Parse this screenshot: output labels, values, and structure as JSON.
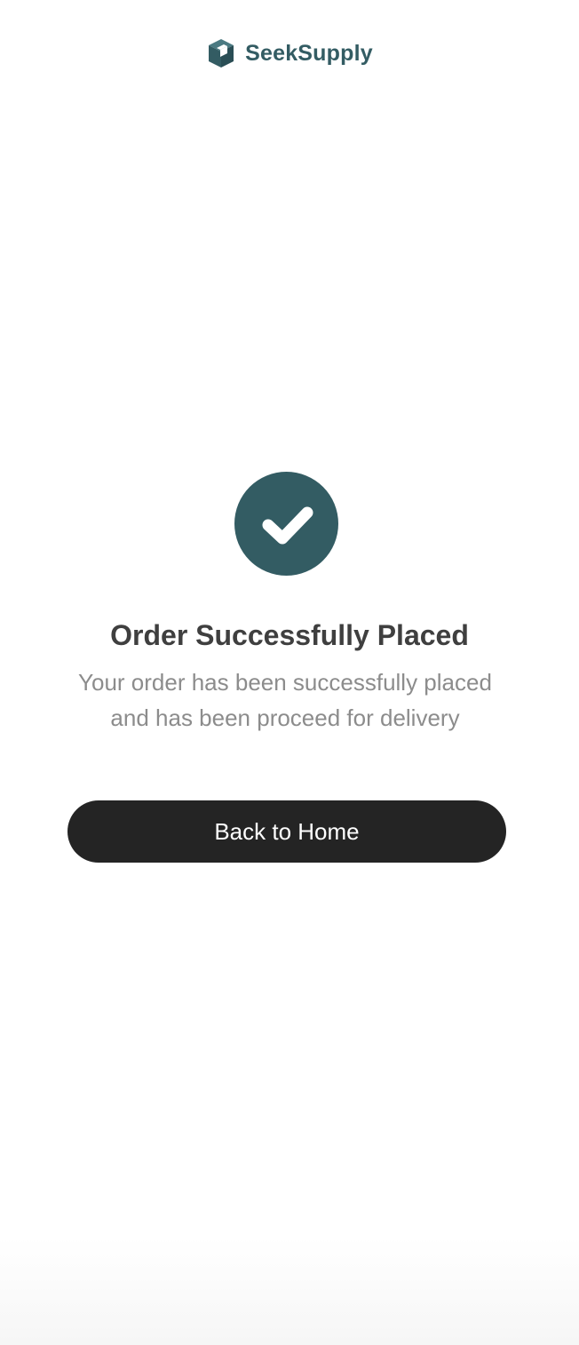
{
  "brand": {
    "name": "SeekSupply",
    "logo_icon": "cube-logo-icon",
    "color": "#335c63"
  },
  "status": {
    "icon": "check-circle-icon",
    "icon_color": "#335c63",
    "title": "Order Successfully Placed",
    "message": "Your order has been successfully placed and has been proceed for delivery"
  },
  "actions": {
    "back_home_label": "Back to Home",
    "button_color": "#242424"
  }
}
